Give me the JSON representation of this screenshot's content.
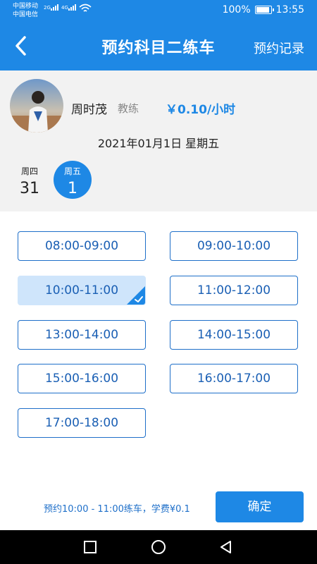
{
  "status_bar": {
    "carrier1": "中国移动",
    "carrier2": "中国电信",
    "net1": "2G",
    "net2": "4G",
    "battery": "100%",
    "battery_level": 1.0,
    "time": "13:55"
  },
  "header": {
    "title": "预约科目二练车",
    "right_link": "预约记录",
    "back_icon": "chevron-left-icon"
  },
  "coach": {
    "name": "周时茂",
    "role": "教练",
    "price": "￥0.10/小时"
  },
  "date": {
    "label": "2021年01月1日 星期五",
    "days": [
      {
        "weekday": "周四",
        "day": "31",
        "selected": false
      },
      {
        "weekday": "周五",
        "day": "1",
        "selected": true
      }
    ]
  },
  "slots": [
    {
      "label": "08:00-09:00",
      "selected": false
    },
    {
      "label": "09:00-10:00",
      "selected": false
    },
    {
      "label": "10:00-11:00",
      "selected": true
    },
    {
      "label": "11:00-12:00",
      "selected": false
    },
    {
      "label": "13:00-14:00",
      "selected": false
    },
    {
      "label": "14:00-15:00",
      "selected": false
    },
    {
      "label": "15:00-16:00",
      "selected": false
    },
    {
      "label": "16:00-17:00",
      "selected": false
    },
    {
      "label": "17:00-18:00",
      "selected": false
    }
  ],
  "footer": {
    "summary": "预约10:00 - 11:00练车，学费¥0.1",
    "confirm_label": "确定"
  },
  "colors": {
    "primary": "#1e88e5",
    "selected_slot_bg": "#cfe5fb",
    "slot_text": "#1a5fb4"
  }
}
